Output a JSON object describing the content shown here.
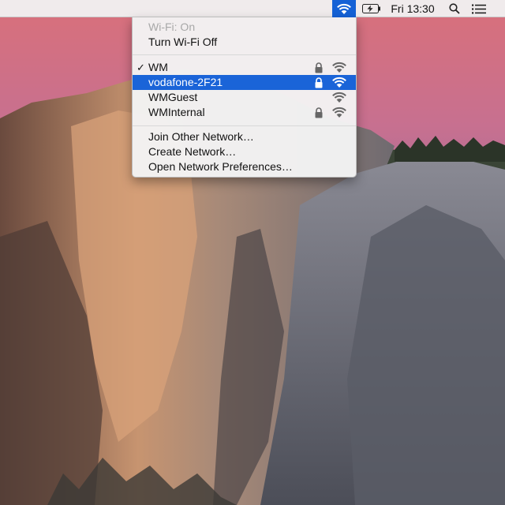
{
  "menubar": {
    "wifi_icon": "wifi-icon",
    "battery_icon": "battery-charging-icon",
    "clock": "Fri 13:30",
    "search_icon": "spotlight-search-icon",
    "notification_icon": "notification-center-icon",
    "active_color": "#1561d6"
  },
  "wifi_menu": {
    "status": "Wi-Fi: On",
    "toggle": "Turn Wi-Fi Off",
    "networks": [
      {
        "name": "WM",
        "connected": true,
        "locked": true
      },
      {
        "name": "vodafone-2F21",
        "highlighted": true,
        "locked": true
      },
      {
        "name": "WMGuest",
        "locked": false
      },
      {
        "name": "WMInternal",
        "locked": true
      }
    ],
    "check_mark": "✓",
    "actions": {
      "join_other": "Join Other Network…",
      "create": "Create Network…",
      "preferences": "Open Network Preferences…"
    },
    "highlight_color": "#1a64d8"
  }
}
